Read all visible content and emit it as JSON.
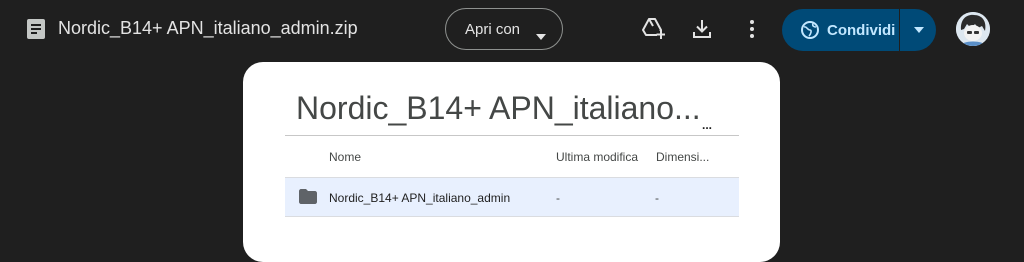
{
  "header": {
    "file_title": "Nordic_B14+ APN_italiano_admin.zip",
    "file_icon": "archive-icon",
    "open_with_label": "Apri con",
    "share_label": "Condividi",
    "share_color": "#004a77"
  },
  "preview": {
    "title": "Nordic_B14+ APN_italiano...",
    "more_label": "...",
    "columns": {
      "name": "Nome",
      "modified": "Ultima modifica",
      "size": "Dimensi..."
    },
    "rows": [
      {
        "name": "Nordic_B14+ APN_italiano_admin",
        "modified": "-",
        "size": "-"
      }
    ]
  }
}
